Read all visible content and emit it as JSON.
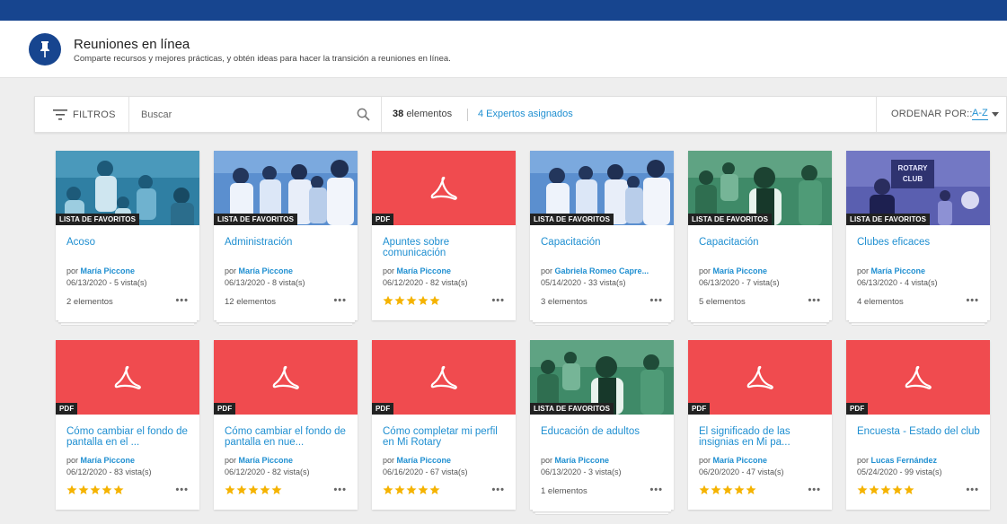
{
  "header": {
    "title": "Reuniones en línea",
    "subtitle": "Comparte recursos y mejores prácticas, y obtén ideas para hacer la transición a reuniones en línea.",
    "icon": "pin-icon"
  },
  "toolbar": {
    "filters_label": "FILTROS",
    "search_placeholder": "Buscar",
    "count_number": "38",
    "count_label": "elementos",
    "experts_label": "4 Expertos asignados",
    "sort_label": "ORDENAR POR::",
    "sort_value": "A-Z"
  },
  "colors": {
    "brand": "#17458f",
    "link": "#1f8fd1",
    "pdf": "#f04b4f",
    "star": "#f5b301"
  },
  "cards": [
    {
      "type": "photo",
      "badge": "LISTA DE FAVORITOS",
      "title": "Acoso",
      "by": "por",
      "author": "María Piccone",
      "date": "06/13/2020 - 5 vista(s)",
      "footer": "2 elementos"
    },
    {
      "type": "photo",
      "badge": "LISTA DE FAVORITOS",
      "title": "Administración",
      "by": "por",
      "author": "María Piccone",
      "date": "06/13/2020 - 8 vista(s)",
      "footer": "12 elementos"
    },
    {
      "type": "pdf",
      "badge": "PDF",
      "title": "Apuntes sobre comunicación",
      "by": "por",
      "author": "María Piccone",
      "date": "06/12/2020 - 82 vista(s)",
      "rating": 5
    },
    {
      "type": "photo",
      "badge": "LISTA DE FAVORITOS",
      "title": "Capacitación",
      "by": "por",
      "author": "Gabriela Romeo Capre...",
      "date": "05/14/2020 - 33 vista(s)",
      "footer": "3 elementos"
    },
    {
      "type": "photo",
      "badge": "LISTA DE FAVORITOS",
      "title": "Capacitación",
      "by": "por",
      "author": "María Piccone",
      "date": "06/13/2020 - 7 vista(s)",
      "footer": "5 elementos"
    },
    {
      "type": "photo",
      "badge": "LISTA DE FAVORITOS",
      "title": "Clubes eficaces",
      "by": "por",
      "author": "María Piccone",
      "date": "06/13/2020 - 4 vista(s)",
      "footer": "4 elementos",
      "sign": "ROTARY CLUB"
    },
    {
      "type": "pdf",
      "badge": "PDF",
      "title": "Cómo cambiar el fondo de pantalla en el ...",
      "by": "por",
      "author": "María Piccone",
      "date": "06/12/2020 - 83 vista(s)",
      "rating": 5
    },
    {
      "type": "pdf",
      "badge": "PDF",
      "title": "Cómo cambiar el fondo de pantalla en nue...",
      "by": "por",
      "author": "María Piccone",
      "date": "06/12/2020 - 82 vista(s)",
      "rating": 5
    },
    {
      "type": "pdf",
      "badge": "PDF",
      "title": "Cómo completar mi perfil en Mi Rotary",
      "by": "por",
      "author": "María Piccone",
      "date": "06/16/2020 - 67 vista(s)",
      "rating": 5
    },
    {
      "type": "photo",
      "badge": "LISTA DE FAVORITOS",
      "title": "Educación de adultos",
      "by": "por",
      "author": "María Piccone",
      "date": "06/13/2020 - 3 vista(s)",
      "footer": "1 elementos"
    },
    {
      "type": "pdf",
      "badge": "PDF",
      "title": "El significado de las insignias en Mi pa...",
      "by": "por",
      "author": "María Piccone",
      "date": "06/20/2020 - 47 vista(s)",
      "rating": 5
    },
    {
      "type": "pdf",
      "badge": "PDF",
      "title": "Encuesta - Estado del club",
      "by": "por",
      "author": "Lucas Fernández",
      "date": "05/24/2020 - 99 vista(s)",
      "rating": 5
    }
  ]
}
